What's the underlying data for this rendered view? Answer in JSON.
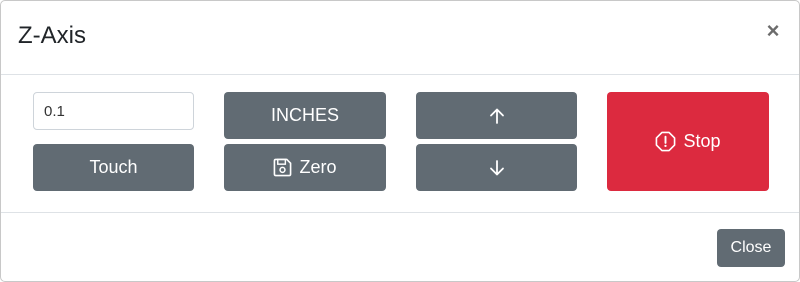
{
  "dialog": {
    "title": "Z-Axis",
    "close_symbol": "×"
  },
  "controls": {
    "step_input_value": "0.1",
    "touch_label": "Touch",
    "units_label": "INCHES",
    "zero_label": "Zero",
    "zero_icon": "floppy-disk-icon",
    "up_icon": "arrow-up-icon",
    "down_icon": "arrow-down-icon",
    "stop_label": "Stop",
    "stop_icon": "stop-octagon-icon"
  },
  "footer": {
    "close_label": "Close"
  },
  "colors": {
    "button_gray": "#616b73",
    "button_red": "#dc2a3f"
  }
}
